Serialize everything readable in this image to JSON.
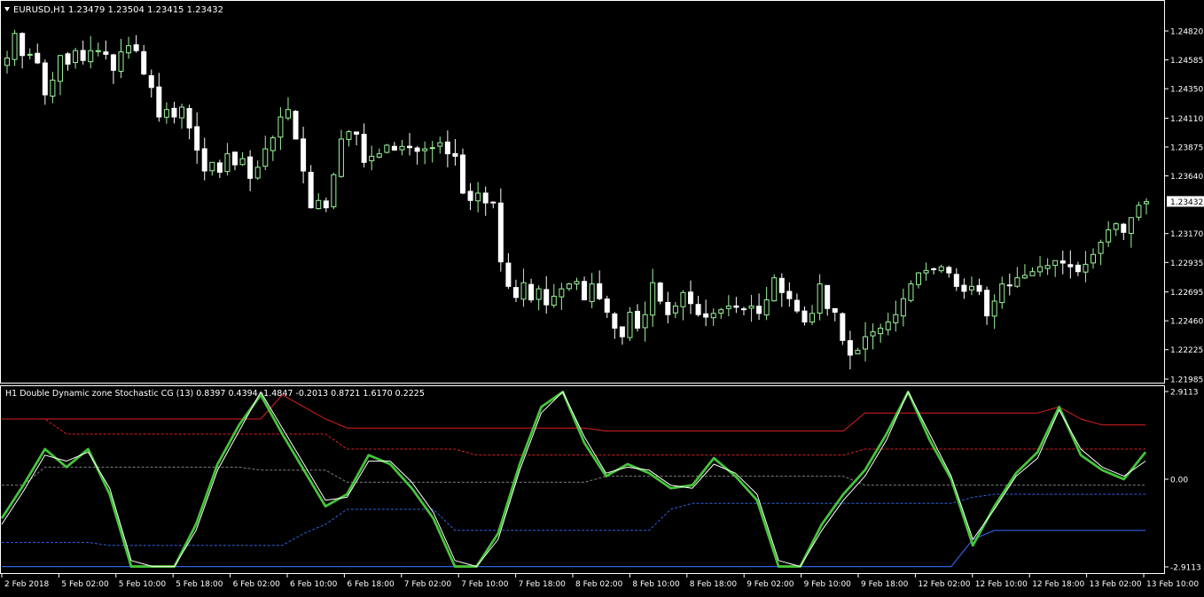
{
  "header": {
    "symbol": "EURUSD,H1",
    "ohlc": "1.23479 1.23504 1.23415 1.23432",
    "indicator": "H1 Double Dynamic zone Stochastic CG (13) 0.8397 0.4394 -1.4847 -0.2013 0.8721 1.6170 0.2225"
  },
  "colors": {
    "background": "#000000",
    "frame": "#ffffff",
    "text": "#ffffff",
    "bull": "#9cf59c",
    "bear": "#ffffff",
    "green": "#3cc83c",
    "orange": "#ff9a00",
    "white_line": "#ffffff",
    "red_line": "#dd2020",
    "blue_line": "#3060dd",
    "gray_dash": "#808080"
  },
  "chart_data": [
    {
      "type": "candlestick",
      "title": "EURUSD,H1",
      "ylim": [
        1.21985,
        1.2498
      ],
      "y_ticks": [
        "1.24820",
        "1.24585",
        "1.24350",
        "1.24110",
        "1.23875",
        "1.23640",
        "1.23170",
        "1.22935",
        "1.22695",
        "1.22460",
        "1.22225",
        "1.21985"
      ],
      "last_price": "1.23432",
      "x_ticks": [
        "2 Feb 2018",
        "5 Feb 02:00",
        "5 Feb 10:00",
        "5 Feb 18:00",
        "6 Feb 02:00",
        "6 Feb 10:00",
        "6 Feb 18:00",
        "7 Feb 02:00",
        "7 Feb 10:00",
        "7 Feb 18:00",
        "8 Feb 02:00",
        "8 Feb 10:00",
        "8 Feb 18:00",
        "9 Feb 02:00",
        "9 Feb 10:00",
        "9 Feb 18:00",
        "12 Feb 02:00",
        "12 Feb 10:00",
        "12 Feb 18:00",
        "13 Feb 02:00",
        "13 Feb 10:00"
      ],
      "closes": [
        1.246,
        1.248,
        1.2462,
        1.2463,
        1.2456,
        1.243,
        1.2442,
        1.2462,
        1.2455,
        1.2466,
        1.2458,
        1.2466,
        1.2466,
        1.2463,
        1.245,
        1.2465,
        1.247,
        1.2466,
        1.2447,
        1.2436,
        1.2412,
        1.2418,
        1.2412,
        1.242,
        1.2403,
        1.2385,
        1.2368,
        1.2375,
        1.2367,
        1.2382,
        1.2373,
        1.2378,
        1.2362,
        1.2371,
        1.2386,
        1.2395,
        1.2412,
        1.2418,
        1.2394,
        1.2368,
        1.2338,
        1.2344,
        1.2338,
        1.2365,
        1.2394,
        1.24,
        1.2398,
        1.2375,
        1.238,
        1.2382,
        1.2389,
        1.2385,
        1.2388,
        1.2387,
        1.2384,
        1.2386,
        1.2387,
        1.2391,
        1.2382,
        1.238,
        1.235,
        1.2344,
        1.235,
        1.2342,
        1.2342,
        1.2294,
        1.2274,
        1.2265,
        1.2277,
        1.2263,
        1.2272,
        1.2259,
        1.2266,
        1.2272,
        1.2276,
        1.2278,
        1.2263,
        1.2276,
        1.2264,
        1.2253,
        1.224,
        1.2233,
        1.2253,
        1.224,
        1.2251,
        1.2277,
        1.2262,
        1.2251,
        1.2258,
        1.2269,
        1.226,
        1.2251,
        1.2249,
        1.2252,
        1.2255,
        1.2258,
        1.2257,
        1.2255,
        1.2258,
        1.2252,
        1.2263,
        1.2281,
        1.2269,
        1.2264,
        1.2254,
        1.2245,
        1.2252,
        1.2276,
        1.2256,
        1.2253,
        1.223,
        1.2218,
        1.2222,
        1.2233,
        1.2237,
        1.224,
        1.2245,
        1.2251,
        1.2264,
        1.2276,
        1.2285,
        1.2287,
        1.2288,
        1.229,
        1.2285,
        1.2274,
        1.227,
        1.2274,
        1.227,
        1.225,
        1.2262,
        1.2276,
        1.2275,
        1.2281,
        1.2283,
        1.2286,
        1.229,
        1.2291,
        1.2295,
        1.2293,
        1.229,
        1.2286,
        1.2292,
        1.23,
        1.231,
        1.232,
        1.2325,
        1.2318,
        1.233,
        1.234,
        1.2343
      ],
      "legend": "none",
      "grid": false
    },
    {
      "type": "line",
      "title": "H1 Double Dynamic zone Stochastic CG (13)",
      "ylim": [
        -2.9113,
        2.9113
      ],
      "y_ticks": [
        "2.9113",
        "0.00",
        "-2.9113"
      ],
      "series": [
        {
          "color": "green",
          "values": [
            -1.3,
            -0.2,
            1.0,
            0.4,
            1.0,
            -0.5,
            -2.9,
            -2.9,
            -2.9,
            -1.5,
            0.5,
            1.8,
            2.8,
            1.5,
            0.3,
            -0.9,
            -0.5,
            0.8,
            0.5,
            -0.3,
            -1.3,
            -2.9,
            -2.9,
            -1.8,
            0.5,
            2.4,
            2.9,
            1.2,
            0.1,
            0.5,
            0.2,
            -0.3,
            -0.2,
            0.7,
            0.1,
            -0.7,
            -2.9,
            -2.9,
            -1.5,
            -0.5,
            0.3,
            1.5,
            2.9,
            1.3,
            0.0,
            -2.2,
            -0.9,
            0.2,
            0.9,
            2.4,
            0.8,
            0.3,
            0.0,
            0.9
          ]
        },
        {
          "color": "orange",
          "values": [
            -1.3,
            -0.2,
            1.0,
            0.4,
            1.0,
            -0.5,
            -2.9,
            -2.9,
            -2.9,
            -1.5,
            0.5,
            1.8,
            2.8,
            1.5,
            0.3,
            -0.9,
            -0.5,
            0.8,
            0.5,
            -0.3,
            -1.3,
            -2.9,
            -2.9,
            -1.8,
            0.5,
            2.4,
            2.9,
            1.2,
            0.1,
            0.5,
            0.2,
            -0.3,
            -0.2,
            0.7,
            0.1,
            -0.7,
            -2.9,
            -2.9,
            -1.5,
            -0.5,
            0.3,
            1.5,
            2.9,
            1.3,
            0.0,
            -2.2,
            -0.9,
            0.2,
            0.9,
            2.4,
            0.8,
            0.3,
            0.0,
            0.9
          ]
        },
        {
          "color": "white",
          "values": [
            -1.5,
            -0.4,
            0.8,
            0.6,
            0.9,
            -0.3,
            -2.7,
            -2.9,
            -2.9,
            -1.7,
            0.3,
            1.6,
            2.9,
            1.7,
            0.5,
            -0.7,
            -0.6,
            0.6,
            0.6,
            -0.1,
            -1.1,
            -2.7,
            -2.9,
            -2.0,
            0.3,
            2.2,
            2.9,
            1.4,
            0.2,
            0.4,
            0.3,
            -0.2,
            -0.3,
            0.5,
            0.2,
            -0.5,
            -2.7,
            -2.9,
            -1.7,
            -0.7,
            0.1,
            1.3,
            2.9,
            1.5,
            0.1,
            -2.0,
            -1.0,
            0.1,
            0.7,
            2.3,
            1.0,
            0.4,
            0.1,
            0.6
          ]
        },
        {
          "color": "red_solid",
          "values": [
            2.0,
            2.0,
            2.0,
            2.0,
            2.0,
            2.0,
            2.0,
            2.0,
            2.0,
            2.0,
            2.0,
            2.0,
            2.0,
            2.8,
            2.4,
            2.0,
            1.7,
            1.7,
            1.7,
            1.7,
            1.7,
            1.7,
            1.7,
            1.7,
            1.7,
            1.7,
            1.7,
            1.7,
            1.6,
            1.6,
            1.6,
            1.6,
            1.6,
            1.6,
            1.6,
            1.6,
            1.6,
            1.6,
            1.6,
            1.6,
            2.2,
            2.2,
            2.2,
            2.2,
            2.2,
            2.2,
            2.2,
            2.2,
            2.2,
            2.4,
            2.0,
            1.8,
            1.8,
            1.8
          ]
        },
        {
          "color": "red_dash",
          "values": [
            2.0,
            2.0,
            2.0,
            1.5,
            1.5,
            1.5,
            1.5,
            1.5,
            1.5,
            1.5,
            1.5,
            1.5,
            1.5,
            1.5,
            1.5,
            1.5,
            1.0,
            1.0,
            1.0,
            1.0,
            1.0,
            1.0,
            0.8,
            0.8,
            0.8,
            0.8,
            0.8,
            0.8,
            0.8,
            0.8,
            0.8,
            0.8,
            0.8,
            0.8,
            0.8,
            0.8,
            0.8,
            0.8,
            0.8,
            0.8,
            1.0,
            1.0,
            1.0,
            1.0,
            1.0,
            1.0,
            1.0,
            1.0,
            1.0,
            1.0,
            1.0,
            1.0,
            1.0,
            1.0
          ]
        },
        {
          "color": "gray_dash",
          "values": [
            -0.2,
            -0.2,
            0.4,
            0.4,
            0.4,
            0.4,
            0.4,
            0.4,
            0.4,
            0.4,
            0.4,
            0.4,
            0.3,
            0.3,
            0.3,
            0.3,
            -0.1,
            -0.1,
            -0.1,
            -0.1,
            -0.1,
            -0.1,
            -0.1,
            -0.1,
            -0.1,
            -0.1,
            -0.1,
            -0.1,
            0.1,
            0.1,
            0.1,
            0.1,
            0.1,
            0.1,
            0.1,
            0.1,
            0.1,
            0.1,
            0.1,
            0.1,
            -0.2,
            -0.2,
            -0.2,
            -0.2,
            -0.2,
            -0.2,
            -0.2,
            -0.2,
            -0.2,
            -0.2,
            -0.2,
            -0.2,
            -0.2,
            -0.2
          ]
        },
        {
          "color": "blue_dash",
          "values": [
            -2.1,
            -2.1,
            -2.1,
            -2.1,
            -2.1,
            -2.2,
            -2.2,
            -2.2,
            -2.2,
            -2.2,
            -2.2,
            -2.2,
            -2.2,
            -2.2,
            -1.8,
            -1.5,
            -1.0,
            -1.0,
            -1.0,
            -1.0,
            -1.0,
            -1.7,
            -1.7,
            -1.7,
            -1.7,
            -1.7,
            -1.7,
            -1.7,
            -1.7,
            -1.7,
            -1.7,
            -1.0,
            -0.8,
            -0.8,
            -0.8,
            -0.8,
            -0.8,
            -0.8,
            -0.8,
            -0.8,
            -0.8,
            -0.8,
            -0.8,
            -0.8,
            -0.8,
            -0.6,
            -0.5,
            -0.5,
            -0.5,
            -0.5,
            -0.5,
            -0.5,
            -0.5,
            -0.5
          ]
        },
        {
          "color": "blue_solid",
          "values": [
            -2.9,
            -2.9,
            -2.9,
            -2.9,
            -2.9,
            -2.9,
            -2.9,
            -2.9,
            -2.9,
            -2.9,
            -2.9,
            -2.9,
            -2.9,
            -2.9,
            -2.9,
            -2.9,
            -2.9,
            -2.9,
            -2.9,
            -2.9,
            -2.9,
            -2.9,
            -2.9,
            -2.9,
            -2.9,
            -2.9,
            -2.9,
            -2.9,
            -2.9,
            -2.9,
            -2.9,
            -2.9,
            -2.9,
            -2.9,
            -2.9,
            -2.9,
            -2.9,
            -2.9,
            -2.9,
            -2.9,
            -2.9,
            -2.9,
            -2.9,
            -2.9,
            -2.9,
            -2.0,
            -1.7,
            -1.7,
            -1.7,
            -1.7,
            -1.7,
            -1.7,
            -1.7,
            -1.7
          ]
        }
      ]
    }
  ]
}
